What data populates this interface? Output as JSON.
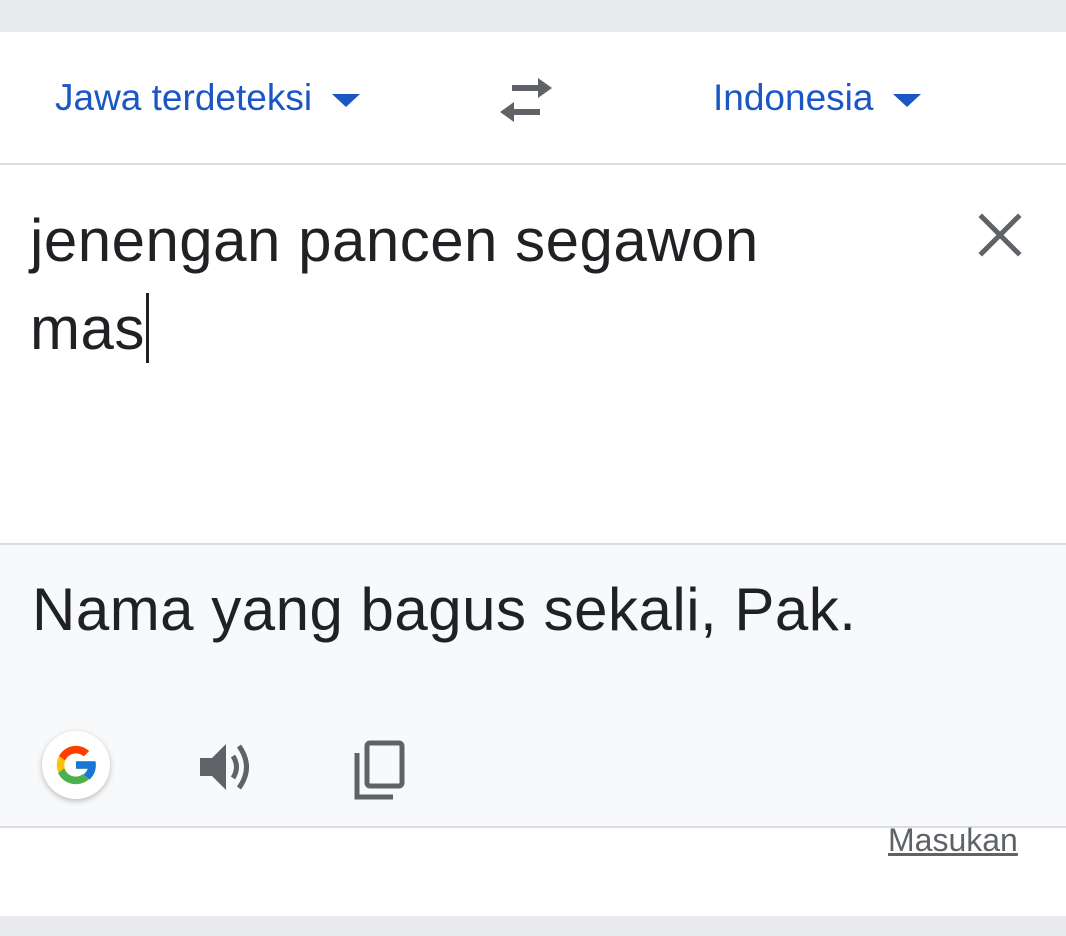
{
  "header": {
    "source_language": "Jawa terdeteksi",
    "target_language": "Indonesia",
    "swap_icon": "swap-arrows-icon",
    "dropdown_icon": "caret-down-icon"
  },
  "input": {
    "line1": "jenengan pancen segawon",
    "line2": "mas",
    "clear_icon": "close-icon"
  },
  "output": {
    "translation": "Nama yang bagus sekali, Pak.",
    "actions": [
      "google-icon",
      "speaker-icon",
      "copy-icon"
    ]
  },
  "footer": {
    "feedback_label": "Masukan"
  },
  "colors": {
    "accent": "#1a56c4",
    "text": "#202124",
    "output_bg": "#f8f9fa",
    "icon_gray": "#5f6368",
    "page_bg": "#e8eaed"
  }
}
